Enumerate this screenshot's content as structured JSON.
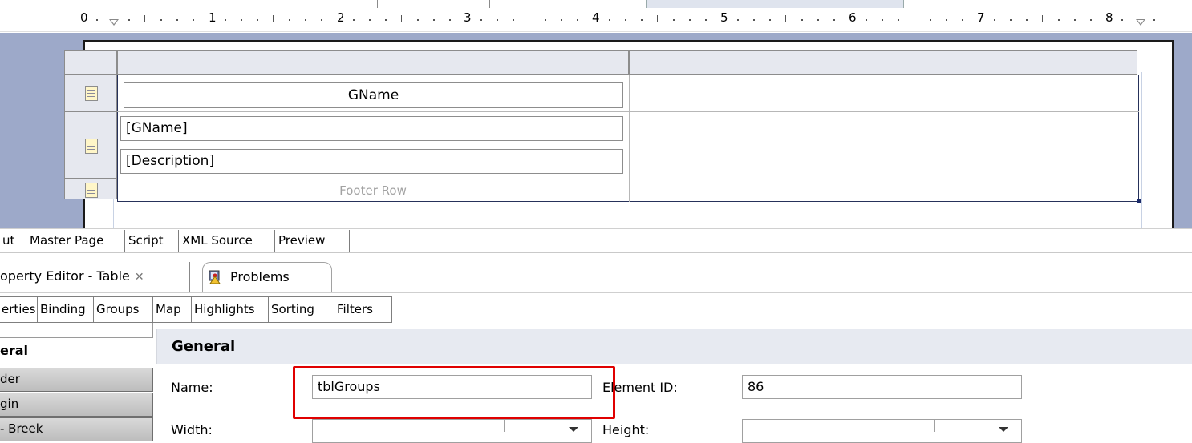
{
  "ruler": {
    "numbers": [
      "0",
      "1",
      "2",
      "3",
      "4",
      "5",
      "6",
      "7",
      "8"
    ]
  },
  "table": {
    "header_label": "GName",
    "detail_fields": [
      "[GName]",
      "[Description]"
    ],
    "footer_label": "Footer Row"
  },
  "editor_tabs": {
    "layout": "ut",
    "master_page": "Master Page",
    "script": "Script",
    "xml_source": "XML Source",
    "preview": "Preview"
  },
  "view_tabs": {
    "property_editor": "operty Editor - Table",
    "problems": "Problems"
  },
  "property_tabs": [
    "erties",
    "Binding",
    "Groups",
    "Map",
    "Highlights",
    "Sorting",
    "Filters"
  ],
  "left_nav": {
    "selected": "eral",
    "items": [
      "der",
      "gin",
      "- Breek"
    ]
  },
  "general": {
    "heading": "General",
    "name_label": "Name:",
    "name_value": "tblGroups",
    "element_id_label": "Element ID:",
    "element_id_value": "86",
    "width_label": "Width:",
    "height_label": "Height:"
  },
  "colors": {
    "canvas": "#9da9c9",
    "highlight": "#e00000",
    "section_header": "#e7eaf1"
  }
}
